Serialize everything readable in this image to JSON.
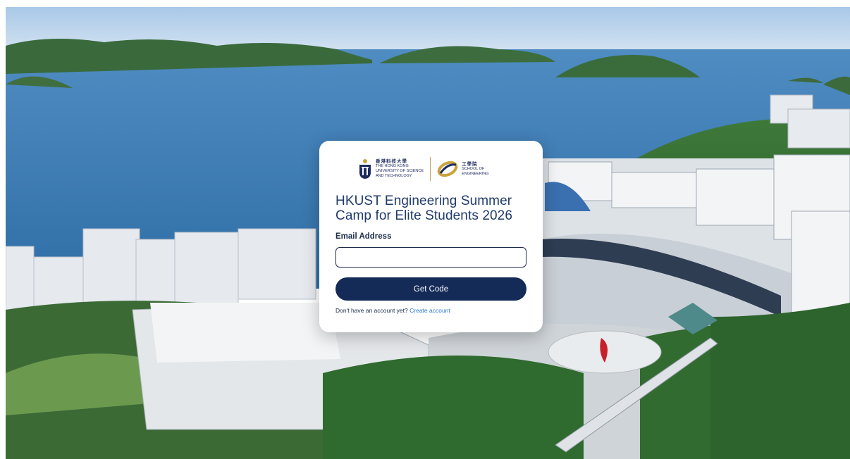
{
  "background": {
    "description_icon": "campus-aerial-photo",
    "colors": {
      "sea": "#3f7fb5",
      "sky": "#c9dcee",
      "hills": "#3d6b3e",
      "buildings": "#e8ecef"
    }
  },
  "logos": {
    "hkust": {
      "zh": "香港科技大學",
      "line1": "THE HONG KONG",
      "line2": "UNIVERSITY OF SCIENCE",
      "line3": "AND TECHNOLOGY"
    },
    "school": {
      "zh": "工學院",
      "line1": "SCHOOL OF",
      "line2": "ENGINEERING"
    }
  },
  "login": {
    "title": "HKUST Engineering Summer Camp for Elite Students 2026",
    "email_label": "Email Address",
    "email_value": "",
    "email_placeholder": "",
    "submit_label": "Get Code",
    "no_account_text": "Don't have an account yet?",
    "create_account_link": "Create account"
  },
  "colors": {
    "primary": "#142a57",
    "link": "#2a7bd6",
    "title": "#1f3a6b"
  }
}
